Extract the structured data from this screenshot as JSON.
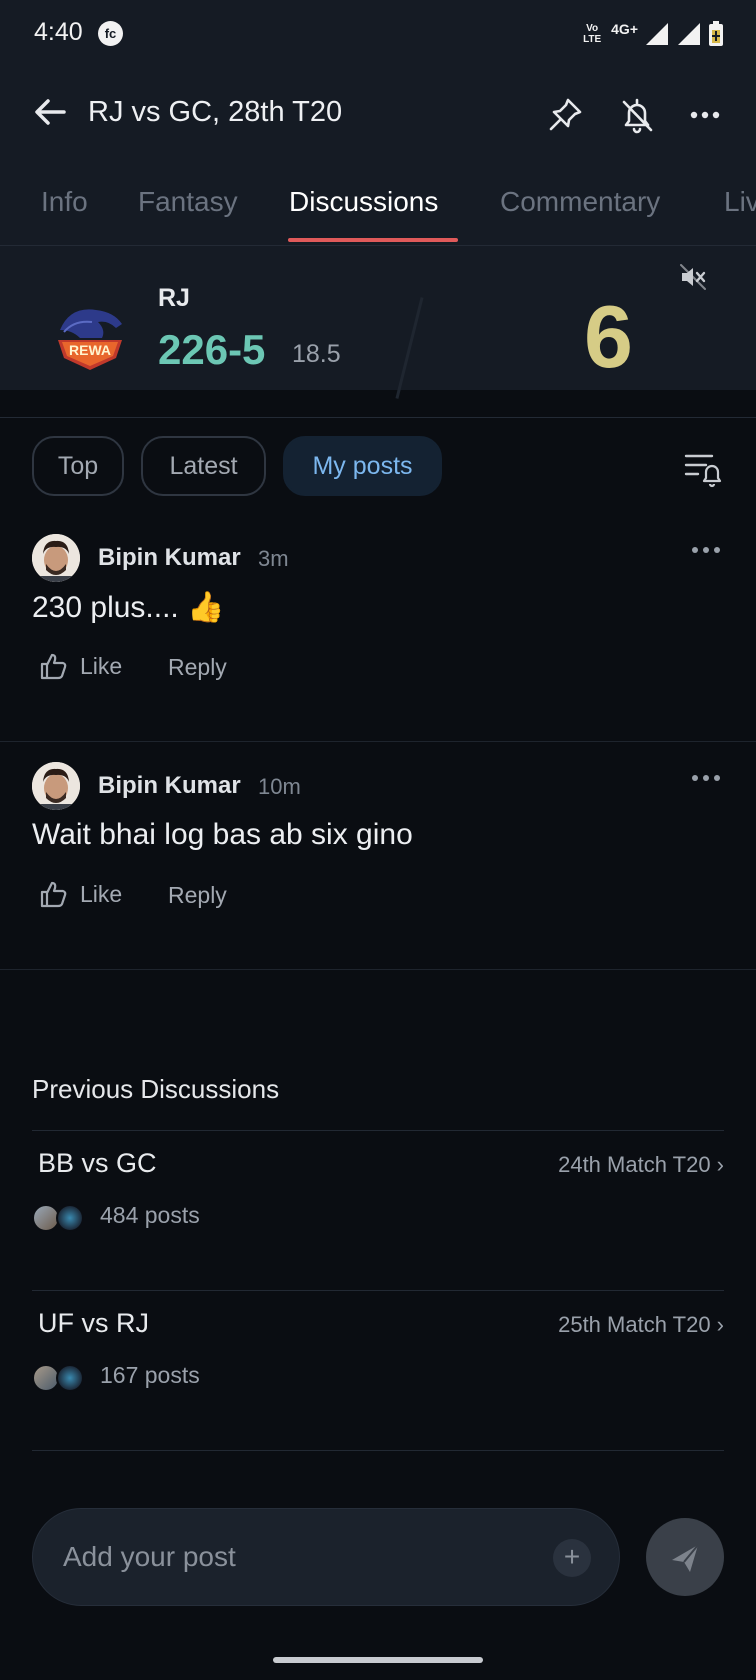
{
  "status_bar": {
    "time": "4:40",
    "fc_badge": "fc",
    "volte": "Vo LTE",
    "network": "4G+"
  },
  "header": {
    "title": "RJ vs GC, 28th T20",
    "icons": [
      "back-arrow-icon",
      "pin-icon",
      "bell-off-icon",
      "more-icon"
    ]
  },
  "tabs": [
    "Info",
    "Fantasy",
    "Discussions",
    "Commentary",
    "Live"
  ],
  "active_tab": "Discussions",
  "scorecard": {
    "team": "RJ",
    "logo_text": "REWA",
    "score": "226-5",
    "overs": "18.5",
    "last_ball": "6"
  },
  "filters": {
    "top": "Top",
    "latest": "Latest",
    "my_posts": "My posts",
    "active": "My posts"
  },
  "posts": [
    {
      "author": "Bipin Kumar",
      "time": "3m",
      "text": "230 plus.... 👍",
      "like": "Like",
      "reply": "Reply"
    },
    {
      "author": "Bipin Kumar",
      "time": "10m",
      "text": "Wait bhai log bas ab six gino",
      "like": "Like",
      "reply": "Reply"
    }
  ],
  "previous": {
    "title": "Previous Discussions",
    "items": [
      {
        "match": "BB vs GC",
        "label": "24th Match T20 ›",
        "posts": "484 posts"
      },
      {
        "match": "UF vs RJ",
        "label": "25th Match T20 ›",
        "posts": "167 posts"
      }
    ]
  },
  "composer": {
    "placeholder": "Add your post",
    "plus": "+"
  },
  "colors": {
    "accent_score": "#6cc7b4",
    "last_ball": "#d6cc86",
    "tab_underline": "#e05a5a",
    "active_chip_text": "#7cb7ee"
  }
}
